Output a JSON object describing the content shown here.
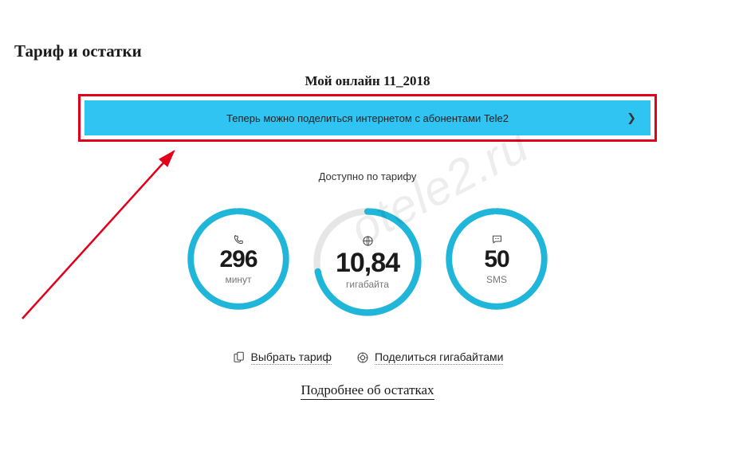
{
  "page_title": "Тариф и остатки",
  "tariff_name": "Мой онлайн 11_2018",
  "banner": {
    "text": "Теперь можно поделиться интернетом с абонентами Tele2"
  },
  "available_label": "Доступно по тарифу",
  "balances": {
    "minutes": {
      "value": "296",
      "unit": "минут",
      "progress": 0.99
    },
    "data": {
      "value": "10,84",
      "unit": "гигабайта",
      "progress": 0.72
    },
    "sms": {
      "value": "50",
      "unit": "SMS",
      "progress": 0.99
    }
  },
  "actions": {
    "choose_tariff": "Выбрать тариф",
    "share_gb": "Поделиться гигабайтами"
  },
  "more_link": "Подробнее об остатках",
  "watermark": "otele2.ru",
  "colors": {
    "ring": "#1fb6d9",
    "ring_bg": "#e6e6e6",
    "banner": "#30c4f2",
    "frame": "#e2001a"
  }
}
